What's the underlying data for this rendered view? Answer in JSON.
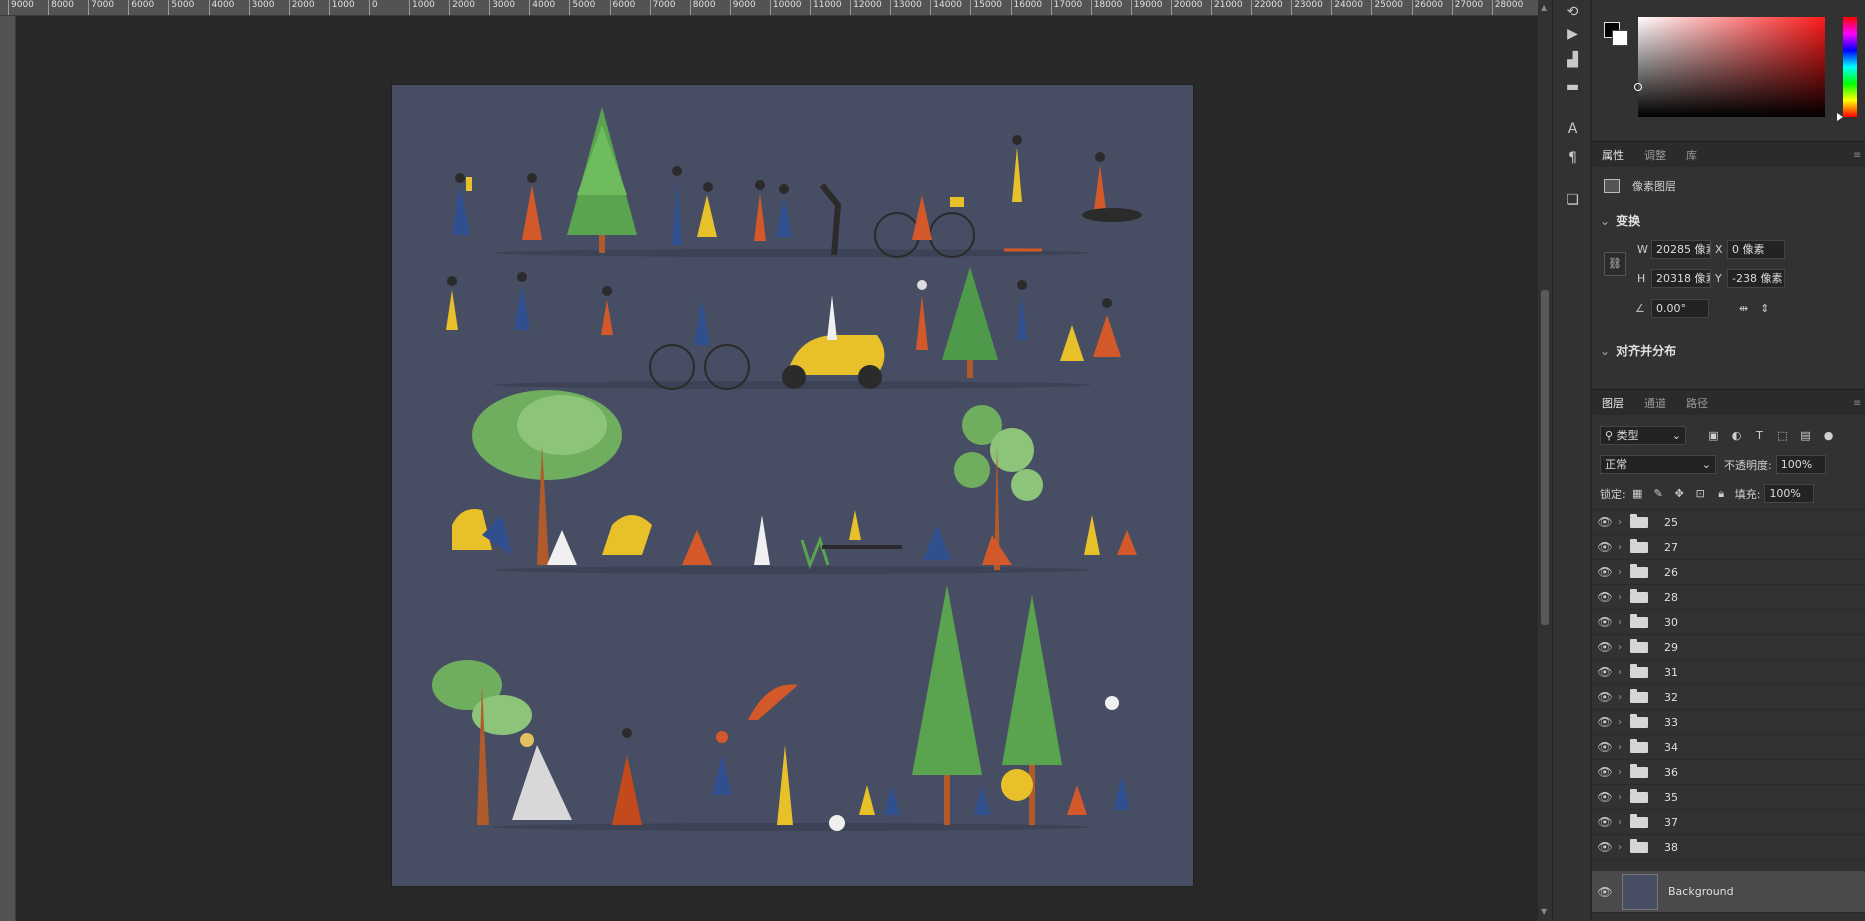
{
  "ruler": {
    "top_ticks": [
      "9000",
      "8000",
      "7000",
      "6000",
      "5000",
      "4000",
      "3000",
      "2000",
      "1000",
      "0",
      "1000",
      "2000",
      "3000",
      "4000",
      "5000",
      "6000",
      "7000",
      "8000",
      "9000",
      "10000",
      "11000",
      "12000",
      "13000",
      "14000",
      "15000",
      "16000",
      "17000",
      "18000",
      "19000",
      "20000",
      "21000",
      "22000",
      "23000",
      "24000",
      "25000",
      "26000",
      "27000",
      "28000"
    ]
  },
  "document": {
    "background_color": "#474e63"
  },
  "tools": [
    {
      "name": "history-icon",
      "glyph": "⟲"
    },
    {
      "name": "play-icon",
      "glyph": "▶"
    },
    {
      "name": "brush-preset-icon",
      "glyph": "▟"
    },
    {
      "name": "comment-icon",
      "glyph": "▬"
    },
    {
      "name": "character-icon",
      "glyph": "A"
    },
    {
      "name": "paragraph-icon",
      "glyph": "¶"
    },
    {
      "name": "layers-comp-icon",
      "glyph": "❏"
    }
  ],
  "properties_panel": {
    "tabs": [
      "属性",
      "调整",
      "库"
    ],
    "active_tab": "属性",
    "layer_kind": "像素图层",
    "transform": {
      "title": "变换",
      "w_label": "W",
      "w_value": "20285 像素",
      "x_label": "X",
      "x_value": "0 像素",
      "h_label": "H",
      "h_value": "20318 像素",
      "y_label": "Y",
      "y_value": "-238 像素",
      "angle_value": "0.00°"
    },
    "align_section": "对齐并分布"
  },
  "layers_panel": {
    "tabs": [
      "图层",
      "通道",
      "路径"
    ],
    "active_tab": "图层",
    "filter_kind": "类型",
    "blend_mode": "正常",
    "opacity_label": "不透明度:",
    "opacity_value": "100%",
    "lock_label": "锁定:",
    "fill_label": "填充:",
    "fill_value": "100%",
    "layers": [
      "25",
      "27",
      "26",
      "28",
      "30",
      "29",
      "31",
      "32",
      "33",
      "34",
      "36",
      "35",
      "37",
      "38"
    ],
    "background_layer": "Background"
  }
}
